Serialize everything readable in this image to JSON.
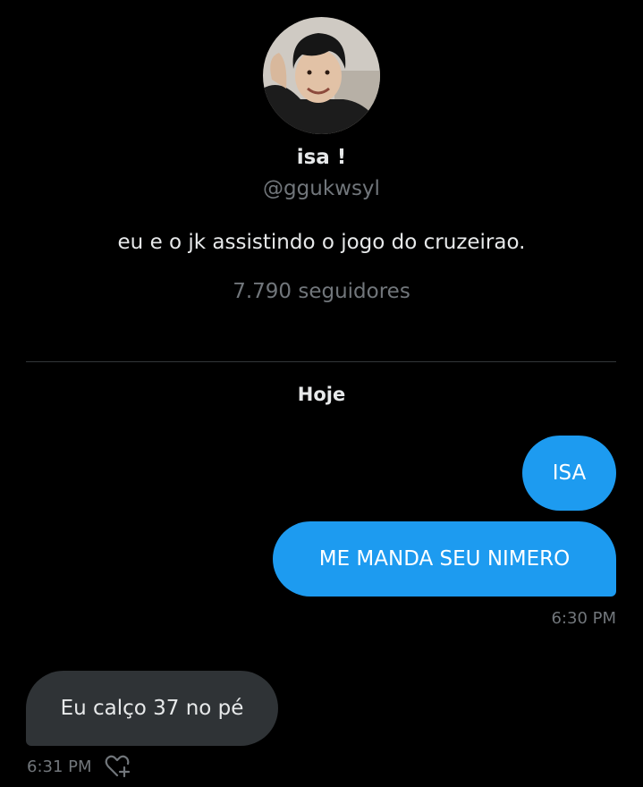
{
  "profile": {
    "name": "isa !",
    "handle": "@ggukwsyl",
    "bio": "eu e o jk assistindo o jogo do cruzeirao.",
    "followers": "7.790 seguidores"
  },
  "conversation": {
    "day_label": "Hoje",
    "messages": [
      {
        "direction": "sent",
        "text": "ISA"
      },
      {
        "direction": "sent",
        "text": "ME MANDA SEU NIMERO",
        "time": "6:30 PM"
      },
      {
        "direction": "received",
        "text": "Eu calço 37 no pé",
        "time": "6:31 PM"
      }
    ]
  },
  "icons": {
    "avatar": "avatar-photo",
    "reaction": "heart-plus-icon"
  },
  "colors": {
    "background": "#000000",
    "sent_bubble": "#1d9bf0",
    "received_bubble": "#2f3336",
    "primary_text": "#e7e9ea",
    "secondary_text": "#71767b",
    "divider": "#333639"
  }
}
